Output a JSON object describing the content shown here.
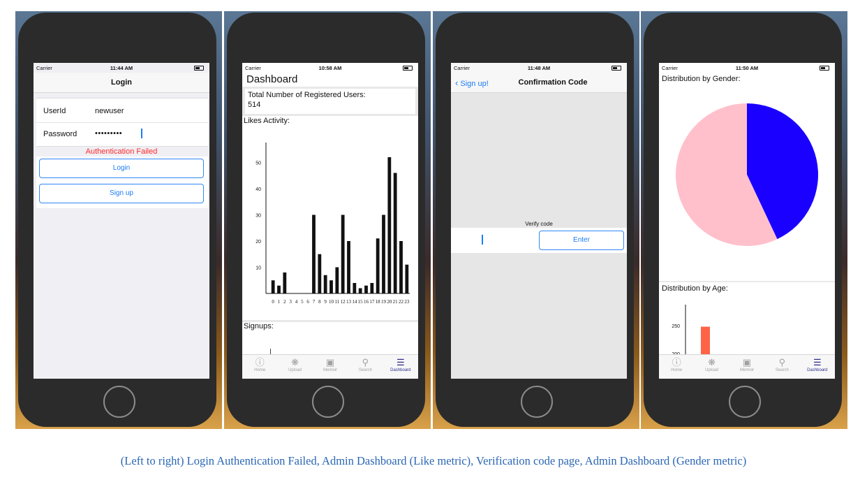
{
  "status_bar": {
    "carrier": "Carrier",
    "times": [
      "11:44 AM",
      "10:58 AM",
      "11:48 AM",
      "11:50 AM"
    ]
  },
  "login": {
    "title": "Login",
    "userid_label": "UserId",
    "userid_value": "newuser",
    "password_label": "Password",
    "password_value": "•••••••••",
    "error": "Authentication Failed",
    "login_button": "Login",
    "signup_button": "Sign up"
  },
  "dashboard": {
    "title": "Dashboard",
    "total_label": "Total Number of Registered Users:",
    "total_value": "514",
    "likes_heading": "Likes Activity:",
    "signups_heading": "Signups:"
  },
  "verify": {
    "back_label": "Sign up!",
    "title": "Confirmation Code",
    "prompt": "Verify code",
    "enter_button": "Enter"
  },
  "gender_dashboard": {
    "gender_heading": "Distribution by Gender:",
    "age_heading": "Distribution by Age:"
  },
  "tabbar": {
    "items": [
      {
        "label": "Home",
        "icon": "info-icon"
      },
      {
        "label": "Upload",
        "icon": "aperture-icon"
      },
      {
        "label": "Memoir",
        "icon": "memoir-icon"
      },
      {
        "label": "Search",
        "icon": "search-icon"
      },
      {
        "label": "Dashboard",
        "icon": "sliders-icon"
      }
    ],
    "active": "Dashboard"
  },
  "caption": "(Left to right) Login Authentication Failed, Admin Dashboard (Like metric), Verification code page, Admin Dashboard (Gender metric)",
  "colors": {
    "ios_blue": "#1a7cf5",
    "error_red": "#ff2a2a",
    "caption_blue": "#2a66b4",
    "gender_pink": "#ffc0cb",
    "gender_blue": "#1a00ff",
    "age_bar": "#ff6347"
  },
  "chart_data": [
    {
      "type": "bar",
      "title": "Likes Activity:",
      "categories": [
        "0",
        "1",
        "2",
        "3",
        "4",
        "5",
        "6",
        "7",
        "8",
        "9",
        "10",
        "11",
        "12",
        "13",
        "14",
        "15",
        "16",
        "17",
        "18",
        "19",
        "20",
        "21",
        "22",
        "23"
      ],
      "values": [
        5,
        3,
        8,
        0,
        0,
        0,
        0,
        30,
        15,
        7,
        5,
        10,
        30,
        20,
        4,
        2,
        3,
        4,
        21,
        30,
        52,
        46,
        20,
        11
      ],
      "yticks": [
        10,
        20,
        30,
        40,
        50
      ],
      "ylim": [
        0,
        56
      ]
    },
    {
      "type": "pie",
      "title": "Distribution by Gender:",
      "values": [
        0.43,
        0.57
      ],
      "colors": [
        "#1a00ff",
        "#ffc0cb"
      ]
    },
    {
      "type": "bar",
      "title": "Distribution by Age:",
      "values": [
        248
      ],
      "yticks": [
        200,
        250
      ],
      "ylim": [
        180,
        280
      ],
      "color": "#ff6347"
    }
  ]
}
